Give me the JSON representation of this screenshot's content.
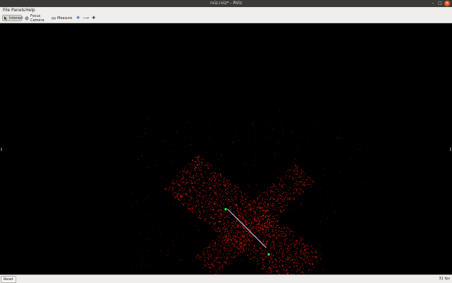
{
  "window": {
    "title": "rviz.rviz* - RViz"
  },
  "menubar": {
    "items": [
      "File",
      "Panels",
      "Help"
    ]
  },
  "toolbar": {
    "tools": [
      {
        "label": "Interact",
        "icon": "interact-icon",
        "active": true
      },
      {
        "label": "Focus Camera",
        "icon": "focus-camera-icon",
        "active": false
      },
      {
        "label": "Measure",
        "icon": "measure-icon",
        "active": false
      }
    ],
    "extra_icons": [
      "2d-pose-estimate-icon",
      "2d-nav-goal-icon",
      "add-tool-icon"
    ]
  },
  "viewport": {
    "background": "#000000",
    "pointcloud_color": "#ff1a0a",
    "path_color": "#c8d2ff",
    "marker_color": "#20ff40"
  },
  "statusbar": {
    "reset_label": "Reset",
    "fps_text": "31 fps"
  },
  "colors": {
    "titlebar": "#3b3a37",
    "chrome": "#efeeec",
    "close": "#e95420"
  }
}
